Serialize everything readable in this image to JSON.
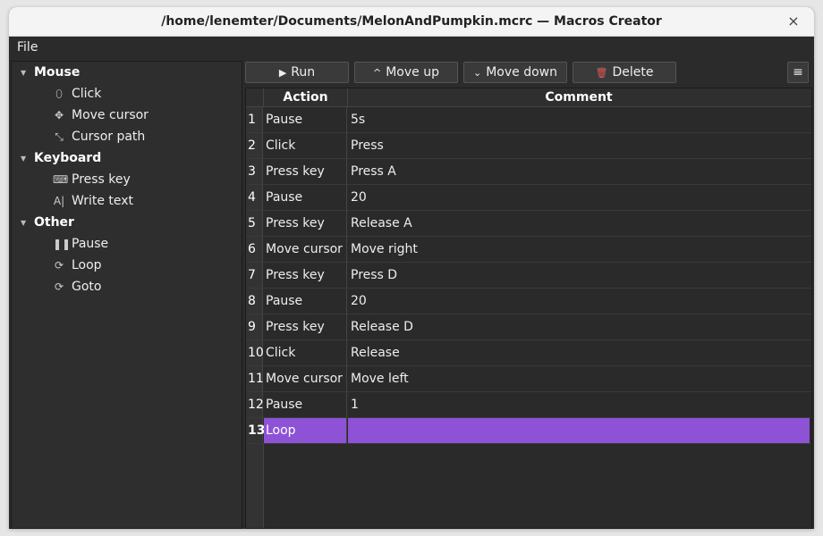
{
  "window": {
    "title": "/home/lenemter/Documents/MelonAndPumpkin.mcrc — Macros Creator",
    "close_glyph": "×"
  },
  "menu": {
    "file_label": "File"
  },
  "sidebar": {
    "groups": [
      {
        "label": "Mouse",
        "items": [
          {
            "label": "Click",
            "icon": "mouse-icon",
            "glyph": "⬯"
          },
          {
            "label": "Move cursor",
            "icon": "move-icon",
            "glyph": "✥"
          },
          {
            "label": "Cursor path",
            "icon": "path-icon",
            "glyph": "⤡"
          }
        ]
      },
      {
        "label": "Keyboard",
        "items": [
          {
            "label": "Press key",
            "icon": "keyboard-icon",
            "glyph": "⌨"
          },
          {
            "label": "Write text",
            "icon": "text-cursor-icon",
            "glyph": "A|"
          }
        ]
      },
      {
        "label": "Other",
        "items": [
          {
            "label": "Pause",
            "icon": "pause-icon",
            "glyph": "❚❚"
          },
          {
            "label": "Loop",
            "icon": "loop-icon",
            "glyph": "⟳"
          },
          {
            "label": "Goto",
            "icon": "goto-icon",
            "glyph": "⟳"
          }
        ]
      }
    ]
  },
  "toolbar": {
    "run_label": "Run",
    "run_glyph": "▶",
    "move_up_label": "Move up",
    "move_up_glyph": "^",
    "move_down_label": "Move down",
    "move_down_glyph": "⌄",
    "delete_label": "Delete",
    "delete_glyph": "🗑",
    "settings_glyph": "≡"
  },
  "table": {
    "headers": {
      "action": "Action",
      "comment": "Comment"
    },
    "rows": [
      {
        "n": "1",
        "action": "Pause",
        "comment": "5s"
      },
      {
        "n": "2",
        "action": "Click",
        "comment": "Press"
      },
      {
        "n": "3",
        "action": "Press key",
        "comment": "Press A"
      },
      {
        "n": "4",
        "action": "Pause",
        "comment": "20"
      },
      {
        "n": "5",
        "action": "Press key",
        "comment": "Release A"
      },
      {
        "n": "6",
        "action": "Move cursor",
        "comment": "Move right"
      },
      {
        "n": "7",
        "action": "Press key",
        "comment": "Press D"
      },
      {
        "n": "8",
        "action": "Pause",
        "comment": "20"
      },
      {
        "n": "9",
        "action": "Press key",
        "comment": "Release D"
      },
      {
        "n": "10",
        "action": "Click",
        "comment": "Release"
      },
      {
        "n": "11",
        "action": "Move cursor",
        "comment": "Move left"
      },
      {
        "n": "12",
        "action": "Pause",
        "comment": "1"
      },
      {
        "n": "13",
        "action": "Loop",
        "comment": ""
      }
    ],
    "selected_row": 13,
    "accent_color": "#8d52d6"
  }
}
